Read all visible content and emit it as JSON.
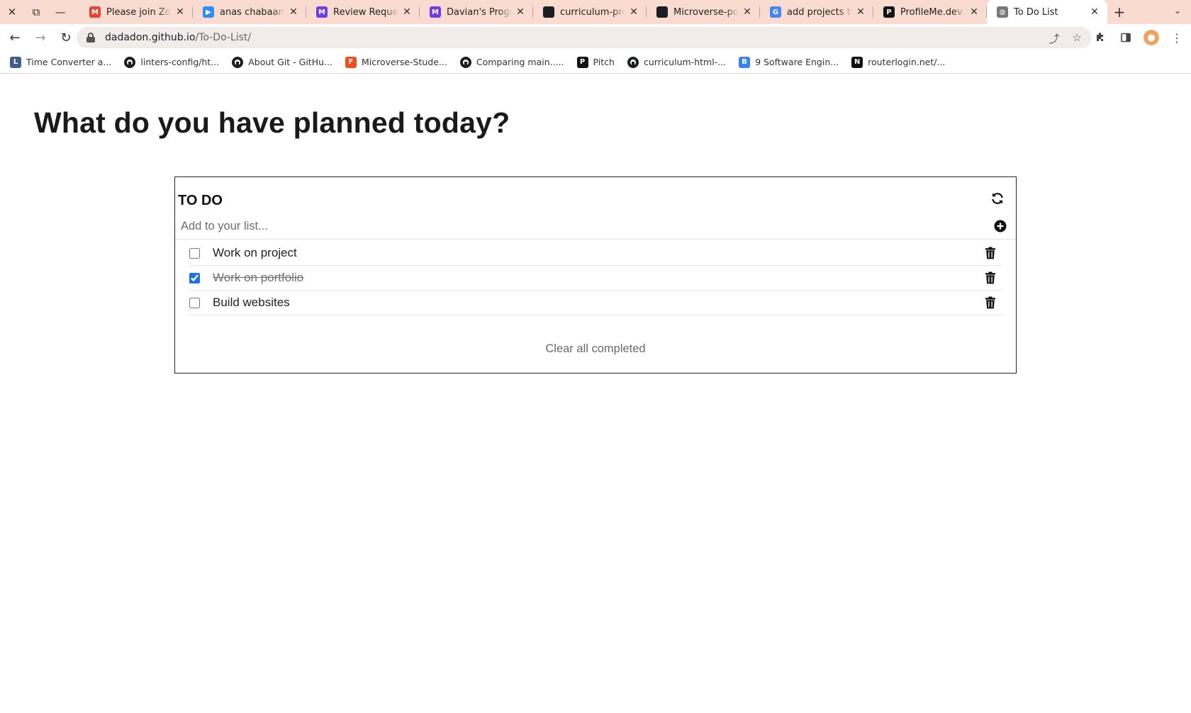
{
  "browser": {
    "window_controls": [
      {
        "name": "close-window-icon",
        "glyph": "✕"
      },
      {
        "name": "restore-window-icon",
        "glyph": "⧉"
      },
      {
        "name": "minimize-window-icon",
        "glyph": "—"
      }
    ],
    "tabs": [
      {
        "title": "Please join Zoom",
        "icon": "gmail-icon",
        "color": "#ea4335",
        "letter": "M",
        "active": false
      },
      {
        "title": "anas chabaane's",
        "icon": "zoom-icon",
        "color": "#2d8cff",
        "letter": "▶",
        "active": false
      },
      {
        "title": "Review Request",
        "icon": "microverse-icon",
        "color": "#6c3ce9",
        "letter": "M",
        "active": false
      },
      {
        "title": "Davian's Progress",
        "icon": "microverse-icon",
        "color": "#6c3ce9",
        "letter": "M",
        "active": false
      },
      {
        "title": "curriculum-professional",
        "icon": "github-icon",
        "color": "#1b1f23",
        "letter": "",
        "active": false
      },
      {
        "title": "Microverse-portfolio",
        "icon": "github-icon",
        "color": "#1b1f23",
        "letter": "",
        "active": false
      },
      {
        "title": "add projects to github",
        "icon": "google-icon",
        "color": "#4285f4",
        "letter": "G",
        "active": false
      },
      {
        "title": "ProfileMe.dev | Create",
        "icon": "profileme-icon",
        "color": "#111111",
        "letter": "P",
        "active": false
      },
      {
        "title": "To Do List",
        "icon": "globe-icon",
        "color": "#777777",
        "letter": "◍",
        "active": true
      }
    ],
    "new_tab": "+",
    "tab_menu": "⌄",
    "url_host": "dadadon.github.io",
    "url_path": "/To-Do-List/",
    "bookmarks": [
      {
        "label": "Time Converter a...",
        "icon": "time-converter-icon",
        "color": "#3f5f8a",
        "letter": "L"
      },
      {
        "label": "linters-config/ht...",
        "icon": "github-icon",
        "color": "#1b1f23",
        "letter": ""
      },
      {
        "label": "About Git - GitHu...",
        "icon": "github-icon",
        "color": "#1b1f23",
        "letter": ""
      },
      {
        "label": "Microverse-Stude...",
        "icon": "figma-icon",
        "color": "#f24e1e",
        "letter": "F"
      },
      {
        "label": "Comparing main.....",
        "icon": "github-icon",
        "color": "#1b1f23",
        "letter": ""
      },
      {
        "label": "Pitch",
        "icon": "pitch-icon",
        "color": "#111111",
        "letter": "P"
      },
      {
        "label": "curriculum-html-...",
        "icon": "github-icon",
        "color": "#1b1f23",
        "letter": ""
      },
      {
        "label": "9 Software Engin...",
        "icon": "bold-b-icon",
        "color": "#3b82f6",
        "letter": "B"
      },
      {
        "label": "routerlogin.net/...",
        "icon": "notion-icon",
        "color": "#111111",
        "letter": "N"
      }
    ]
  },
  "page": {
    "heading": "What do you have planned today?",
    "card": {
      "title": "TO DO",
      "input_placeholder": "Add to your list...",
      "input_value": "",
      "tasks": [
        {
          "text": "Work on project",
          "completed": false
        },
        {
          "text": "Work on portfolio",
          "completed": true
        },
        {
          "text": "Build websites",
          "completed": false
        }
      ],
      "clear_label": "Clear all completed"
    }
  },
  "colors": {
    "tabstrip_bg": "#f9dccf",
    "checkbox_accent": "#1a73e8",
    "card_border": "#222222"
  }
}
